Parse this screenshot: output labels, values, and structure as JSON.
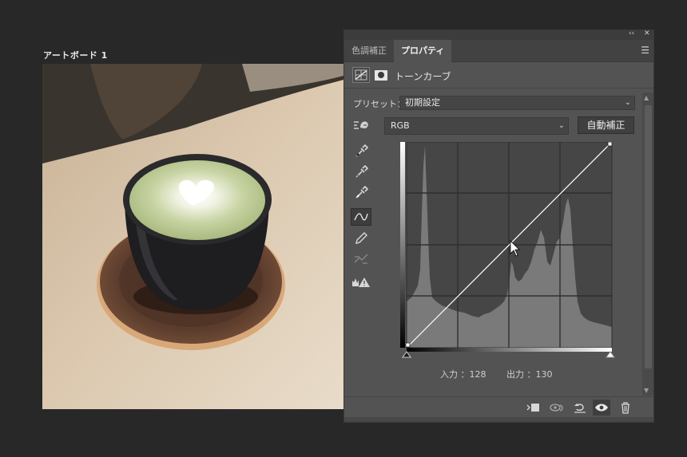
{
  "artboard": {
    "label": "アートボード 1"
  },
  "panel": {
    "tabs": [
      {
        "label": "色調補正",
        "active": false
      },
      {
        "label": "プロパティ",
        "active": true
      }
    ],
    "title": "トーンカーブ",
    "preset": {
      "label": "プリセット：",
      "value": "初期設定"
    },
    "channel": {
      "value": "RGB"
    },
    "auto_label": "自動補正",
    "readout": {
      "input": "入力 ：128",
      "output": "出力 ：130"
    },
    "tools": [
      "channel-pick-icon",
      "black-eyedropper-icon",
      "gray-eyedropper-icon",
      "white-eyedropper-icon",
      "curve-point-icon",
      "pencil-icon",
      "smooth-icon",
      "clipping-warning-icon"
    ],
    "bottom_icons": [
      "clip-to-layer-icon",
      "view-previous-icon",
      "reset-icon",
      "visibility-eye-icon",
      "trash-icon"
    ]
  },
  "colors": {
    "background": "#282828",
    "panel": "#535353",
    "curve_grid_bg": "#464646",
    "histogram": "#7a7a7a"
  }
}
